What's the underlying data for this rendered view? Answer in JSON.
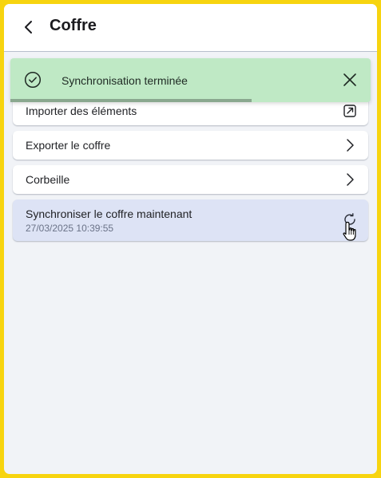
{
  "header": {
    "title": "Coffre",
    "back_icon": "chevron-left-icon"
  },
  "toast": {
    "message": "Synchronisation terminée",
    "icon": "check-circle-icon",
    "close_icon": "close-icon",
    "progress": 0.67,
    "color": "#bfe9c5"
  },
  "items": [
    {
      "label": "Importer des éléments",
      "icon": "external-link-icon"
    },
    {
      "label": "Exporter le coffre",
      "icon": "chevron-right-icon"
    },
    {
      "label": "Corbeille",
      "icon": "chevron-right-icon"
    }
  ],
  "sync": {
    "label": "Synchroniser le coffre maintenant",
    "timestamp": "27/03/2025 10:39:55",
    "icon": "refresh-icon",
    "color": "#dde3f5"
  },
  "colors": {
    "border": "#f7d40f",
    "background": "#f1f3f7"
  }
}
